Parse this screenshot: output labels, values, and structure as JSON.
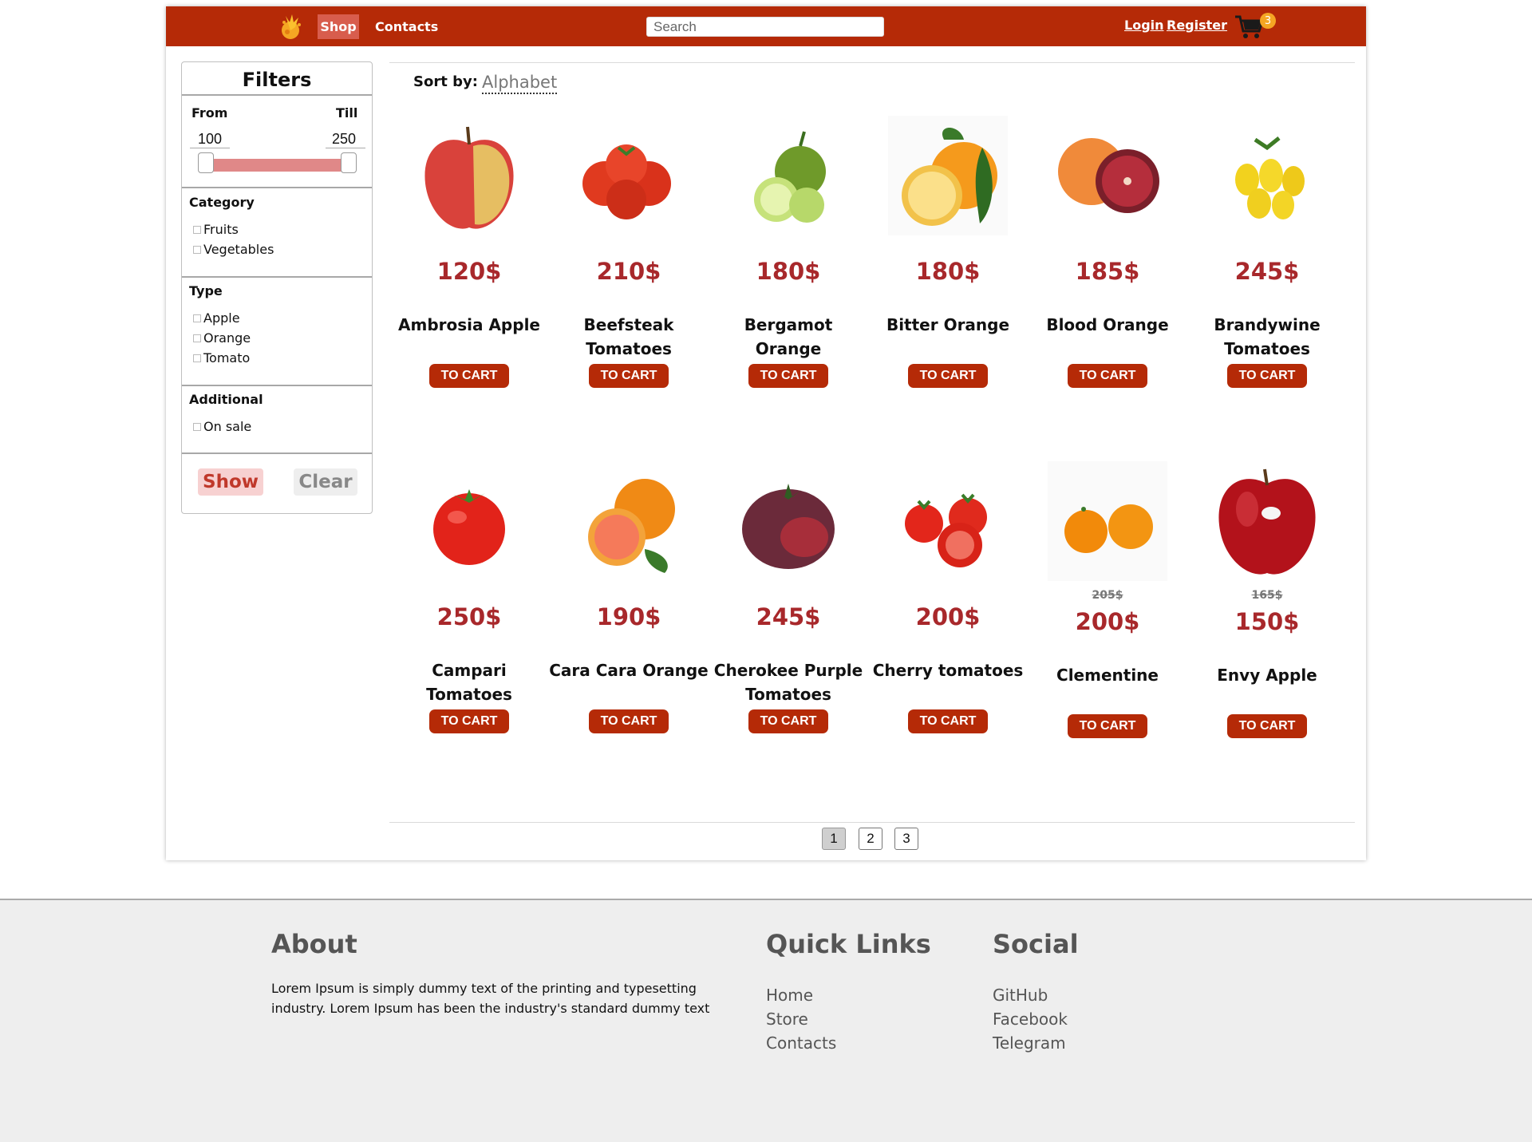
{
  "nav": {
    "shop": "Shop",
    "contacts": "Contacts",
    "search_placeholder": "Search",
    "login": "Login",
    "register": "Register",
    "cart_count": "3"
  },
  "filters": {
    "title": "Filters",
    "from_label": "From",
    "till_label": "Till",
    "from_value": "100",
    "till_value": "250",
    "category_label": "Category",
    "categories": [
      "Fruits",
      "Vegetables"
    ],
    "type_label": "Type",
    "types": [
      "Apple",
      "Orange",
      "Tomato"
    ],
    "additional_label": "Additional",
    "additional": [
      "On sale"
    ],
    "show_label": "Show",
    "clear_label": "Clear"
  },
  "sort": {
    "label": "Sort by:",
    "value": "Alphabet"
  },
  "cart_button_label": "TO CART",
  "products": [
    {
      "name": "Ambrosia Apple",
      "price": "120$",
      "old_price": "",
      "image": "apple"
    },
    {
      "name": "Beefsteak Tomatoes",
      "price": "210$",
      "old_price": "",
      "image": "tomato-cluster"
    },
    {
      "name": "Bergamot Orange",
      "price": "180$",
      "old_price": "",
      "image": "bergamot"
    },
    {
      "name": "Bitter Orange",
      "price": "180$",
      "old_price": "",
      "image": "bitter-orange"
    },
    {
      "name": "Blood Orange",
      "price": "185$",
      "old_price": "",
      "image": "blood-orange"
    },
    {
      "name": "Brandywine Tomatoes",
      "price": "245$",
      "old_price": "",
      "image": "yellow-tomatoes"
    },
    {
      "name": "Campari Tomatoes",
      "price": "250$",
      "old_price": "",
      "image": "tomato"
    },
    {
      "name": "Cara Cara Orange",
      "price": "190$",
      "old_price": "",
      "image": "cara-cara"
    },
    {
      "name": "Cherokee Purple Tomatoes",
      "price": "245$",
      "old_price": "",
      "image": "purple-tomato"
    },
    {
      "name": "Cherry tomatoes",
      "price": "200$",
      "old_price": "",
      "image": "cherry-tomatoes"
    },
    {
      "name": "Clementine",
      "price": "200$",
      "old_price": "205$",
      "image": "clementine"
    },
    {
      "name": "Envy Apple",
      "price": "150$",
      "old_price": "165$",
      "image": "red-apple"
    }
  ],
  "pagination": [
    "1",
    "2",
    "3"
  ],
  "footer": {
    "about_title": "About",
    "about_text": "Lorem Ipsum is simply dummy text of the printing and typesetting industry. Lorem Ipsum has been the industry's standard dummy text",
    "quick_title": "Quick Links",
    "quick_links": [
      "Home",
      "Store",
      "Contacts"
    ],
    "social_title": "Social",
    "social_links": [
      "GitHub",
      "Facebook",
      "Telegram"
    ]
  }
}
